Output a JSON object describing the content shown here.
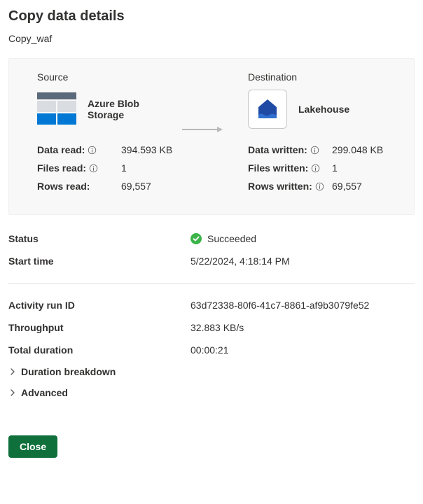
{
  "title": "Copy data details",
  "subtitle": "Copy_waf",
  "source": {
    "heading": "Source",
    "service_name": "Azure Blob Storage",
    "stats": {
      "data_read_label": "Data read:",
      "data_read_value": "394.593 KB",
      "files_read_label": "Files read:",
      "files_read_value": "1",
      "rows_read_label": "Rows read:",
      "rows_read_value": "69,557"
    }
  },
  "destination": {
    "heading": "Destination",
    "service_name": "Lakehouse",
    "stats": {
      "data_written_label": "Data written:",
      "data_written_value": "299.048 KB",
      "files_written_label": "Files written:",
      "files_written_value": "1",
      "rows_written_label": "Rows written:",
      "rows_written_value": "69,557"
    }
  },
  "details": {
    "status_label": "Status",
    "status_value": "Succeeded",
    "start_time_label": "Start time",
    "start_time_value": "5/22/2024, 4:18:14 PM",
    "activity_run_id_label": "Activity run ID",
    "activity_run_id_value": "63d72338-80f6-41c7-8861-af9b3079fe52",
    "throughput_label": "Throughput",
    "throughput_value": "32.883 KB/s",
    "total_duration_label": "Total duration",
    "total_duration_value": "00:00:21",
    "duration_breakdown_label": "Duration breakdown",
    "advanced_label": "Advanced"
  },
  "buttons": {
    "close": "Close"
  }
}
